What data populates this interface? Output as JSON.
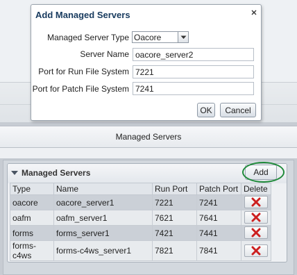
{
  "dialog": {
    "title": "Add Managed Servers",
    "fields": {
      "type_label": "Managed Server Type",
      "type_value": "Oacore",
      "name_label": "Server Name",
      "name_value": "oacore_server2",
      "run_label": "Port for Run File System",
      "run_value": "7221",
      "patch_label": "Port for Patch File System",
      "patch_value": "7241"
    },
    "ok_label": "OK",
    "cancel_label": "Cancel"
  },
  "page": {
    "section_header": "Managed Servers"
  },
  "panel": {
    "title": "Managed Servers",
    "add_label": "Add",
    "columns": [
      "Type",
      "Name",
      "Run Port",
      "Patch Port",
      "Delete"
    ],
    "rows": [
      {
        "type": "oacore",
        "name": "oacore_server1",
        "run_port": "7221",
        "patch_port": "7241"
      },
      {
        "type": "oafm",
        "name": "oafm_server1",
        "run_port": "7621",
        "patch_port": "7641"
      },
      {
        "type": "forms",
        "name": "forms_server1",
        "run_port": "7421",
        "patch_port": "7441"
      },
      {
        "type": "forms-c4ws",
        "name": "forms-c4ws_server1",
        "run_port": "7821",
        "patch_port": "7841"
      }
    ]
  },
  "colors": {
    "dialog_title": "#173a5e",
    "highlight_ring": "#1f8a3a",
    "delete_icon": "#cc1f1f"
  },
  "icons": {
    "close": "close-icon",
    "dropdown": "chevron-down-icon",
    "collapse": "triangle-down-icon",
    "delete": "red-x-icon"
  }
}
